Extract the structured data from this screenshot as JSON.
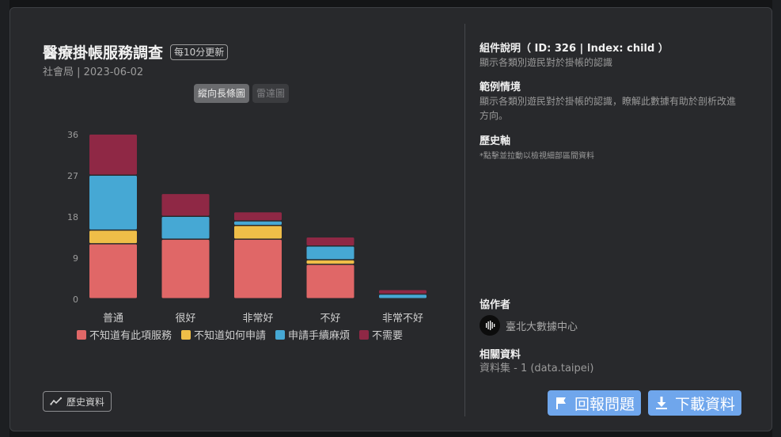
{
  "header": {
    "title": "醫療掛帳服務調查",
    "badge": "每10分更新",
    "subtitle": "社會局 | 2023-06-02"
  },
  "view_toggle": {
    "active": "縱向長條圖",
    "inactive": "雷達圖"
  },
  "chart_data": {
    "type": "bar",
    "stacked": true,
    "categories": [
      "普通",
      "很好",
      "非常好",
      "不好",
      "非常不好"
    ],
    "series": [
      {
        "name": "不知道有此項服務",
        "color": "#e06767",
        "values": [
          12,
          13,
          13,
          7.5,
          0
        ]
      },
      {
        "name": "不知道如何申請",
        "color": "#efbe48",
        "values": [
          3,
          0,
          3,
          1,
          0
        ]
      },
      {
        "name": "申請手續麻煩",
        "color": "#46a8d4",
        "values": [
          12,
          5,
          1,
          3,
          1
        ]
      },
      {
        "name": "不需要",
        "color": "#8f2845",
        "values": [
          9,
          5,
          2,
          2,
          1
        ]
      }
    ],
    "yticks": [
      0,
      9,
      18,
      27,
      36
    ],
    "ylim": [
      0,
      36
    ]
  },
  "history_button": {
    "label": "歷史資料"
  },
  "info": {
    "component_title": "組件說明（ ID: 326 | Index: child ）",
    "component_desc": "顯示各類別遊民對於掛帳的認識",
    "scenario_title": "範例情境",
    "scenario_desc": "顯示各類別遊民對於掛帳的認識，瞭解此數據有助於剖析改進方向。",
    "history_title": "歷史軸",
    "history_note": "*點擊並拉動以檢視細部區間資料",
    "collaborator_title": "協作者",
    "collaborator_name": "臺北大數據中心",
    "related_title": "相關資料",
    "related_link": "資料集 - 1 (data.taipei)"
  },
  "actions": {
    "report": "回報問題",
    "download": "下載資料"
  },
  "colors": {
    "accent": "#6fa6ec",
    "panel": "#28292c"
  }
}
